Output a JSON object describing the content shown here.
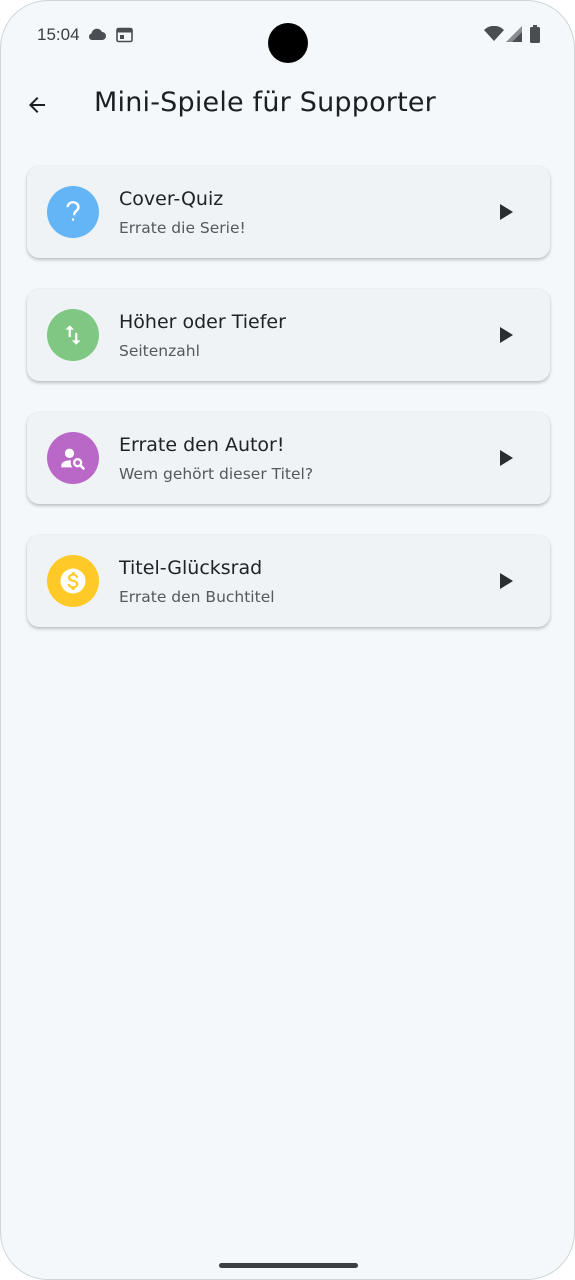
{
  "status_bar": {
    "time": "15:04",
    "icons": [
      "cloud-icon",
      "calendar-icon",
      "wifi-icon",
      "signal-icon",
      "battery-icon"
    ]
  },
  "app_bar": {
    "back_icon": "arrow-back-icon",
    "title": "Mini-Spiele für Supporter"
  },
  "games": [
    {
      "title": "Cover-Quiz",
      "subtitle": "Errate die Serie!",
      "icon": "question-mark-icon",
      "color": "#64b5f6"
    },
    {
      "title": "Höher oder Tiefer",
      "subtitle": "Seitenzahl",
      "icon": "swap-vert-icon",
      "color": "#81c784"
    },
    {
      "title": "Errate den Autor!",
      "subtitle": "Wem gehört dieser Titel?",
      "icon": "person-search-icon",
      "color": "#ba68c8"
    },
    {
      "title": "Titel-Glücksrad",
      "subtitle": "Errate den Buchtitel",
      "icon": "dollar-coin-icon",
      "color": "#ffca28"
    }
  ],
  "colors": {
    "background": "#f4f8fb",
    "card": "#eff3f6",
    "text_primary": "#1c1f22",
    "text_secondary": "#55595d"
  }
}
